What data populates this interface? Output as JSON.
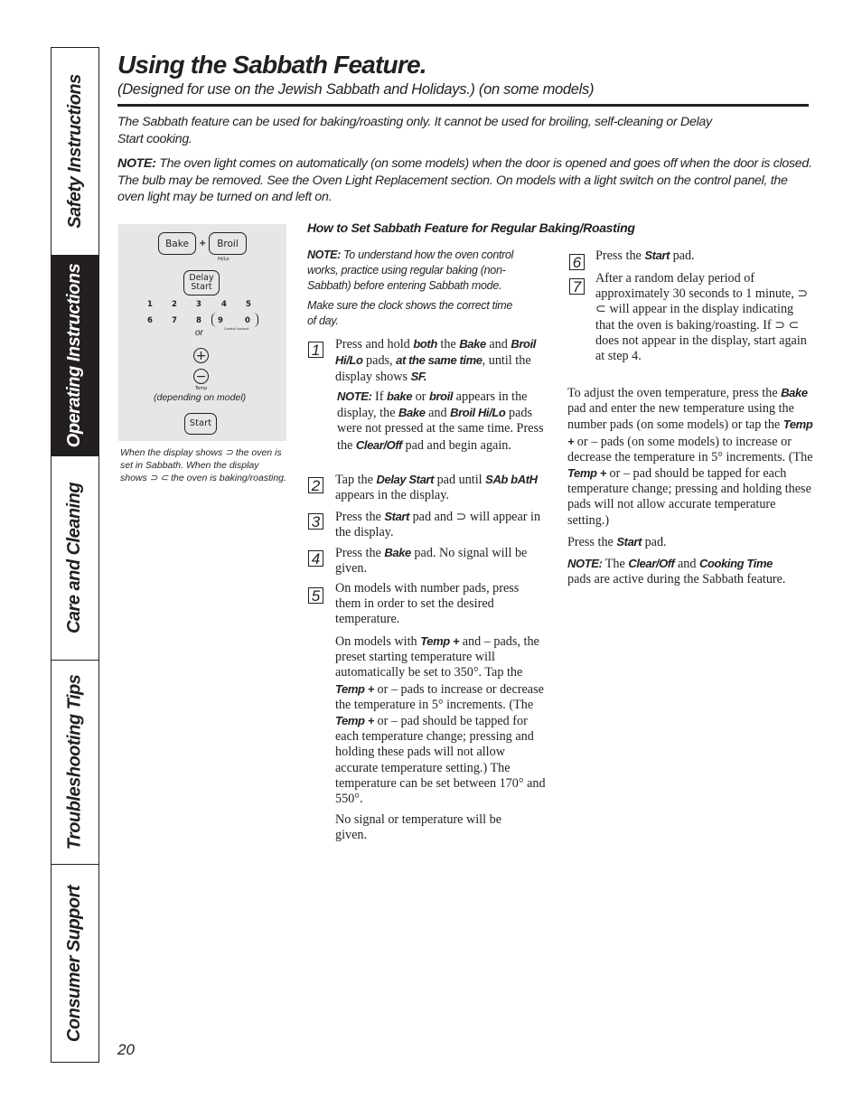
{
  "side_tabs": [
    {
      "label": "Safety Instructions",
      "active": false
    },
    {
      "label": "Operating Instructions",
      "active": true
    },
    {
      "label": "Care and Cleaning",
      "active": false
    },
    {
      "label": "Troubleshooting Tips",
      "active": false
    },
    {
      "label": "Consumer Support",
      "active": false
    }
  ],
  "header": {
    "title": "Using the Sabbath Feature.",
    "subtitle": "(Designed for use on the Jewish Sabbath and Holidays.) (on some models)"
  },
  "intro": {
    "line1": "The Sabbath feature can be used for baking/roasting only. It cannot be used for broiling, self-cleaning or Delay Start cooking.",
    "note_label": "NOTE:",
    "note_text": " The oven light comes on automatically (on some models) when the door is opened and goes off when the door is closed. The bulb may be removed. See the Oven Light Replacement section. On models with a light switch on the control panel, the oven light may be turned on and left on."
  },
  "panel": {
    "bake": "Bake",
    "plus": "+",
    "broil": "Broil",
    "hilo": "Hi/Lo",
    "delay_start": "Delay Start",
    "numbers": [
      "1",
      "2",
      "3",
      "4",
      "5",
      "6",
      "7",
      "8",
      "9",
      "0"
    ],
    "control_lockout": "Control Lockout",
    "or": "or",
    "temp_plus": "+",
    "temp_minus": "−",
    "temp": "Temp",
    "depending": "(depending on model)",
    "start": "Start"
  },
  "caption": "When the display shows ⊃ the oven is set in Sabbath. When the display shows ⊃ ⊂  the oven is baking/roasting.",
  "section": {
    "heading": "How to Set Sabbath Feature for Regular Baking/Roasting",
    "note1_label": "NOTE:",
    "note1_text": " To understand how the oven control works, practice using regular baking (non-Sabbath) before entering Sabbath mode.",
    "note2": "Make sure the clock shows the correct time of day.",
    "steps": [
      {
        "n": "1"
      },
      {
        "n": "2"
      },
      {
        "n": "3"
      },
      {
        "n": "4"
      },
      {
        "n": "5"
      },
      {
        "n": "6"
      },
      {
        "n": "7"
      }
    ],
    "s1": {
      "a": "Press and hold ",
      "b": "both",
      "c": " the ",
      "d": "Bake",
      "e": " and ",
      "f": "Broil Hi/Lo",
      "g": " pads, ",
      "h": "at the same time",
      "i": ", until the display shows ",
      "j": "SF."
    },
    "s1note": {
      "a": "NOTE:",
      "b": " If ",
      "c": "bake",
      "d": " or ",
      "e": "broil",
      "f": " appears in the display, the ",
      "g": "Bake",
      "h": " and ",
      "i": "Broil Hi/Lo",
      "j": " pads were not pressed at the same time. Press the ",
      "k": "Clear/Off",
      "l": " pad and begin again."
    },
    "s2": {
      "a": "Tap the ",
      "b": "Delay Start",
      "c": " pad until ",
      "d": "SAb bAtH",
      "e": " appears in the display."
    },
    "s3": {
      "a": "Press the ",
      "b": "Start",
      "c": " pad and ⊃ will appear in the display."
    },
    "s4": {
      "a": "Press the ",
      "b": "Bake",
      "c": " pad. No signal will be given."
    },
    "s5": {
      "a": "On models with number pads, press them in order to set the desired temperature."
    },
    "s5b": {
      "a": "On models with ",
      "b": "Temp +",
      "c": "  and – pads, the preset starting temperature will automatically be set to 350°. Tap the ",
      "d": "Temp +",
      "e": " or – pads to increase or decrease the temperature in 5° increments. (The ",
      "f": "Temp +",
      "g": " or – pad should be tapped for each temperature change; pressing and holding these pads will not allow accurate temperature setting.) The temperature can be set between 170° and 550°."
    },
    "s5c": "No signal or temperature will be given.",
    "s6": {
      "a": "Press the ",
      "b": "Start",
      "c": " pad."
    },
    "s7": "After a random delay period of approximately 30 seconds to 1 minute, ⊃ ⊂ will appear in the display indicating that the oven is baking/roasting. If ⊃ ⊂ does not appear in the display, start again at step 4.",
    "adjust": {
      "a": "To adjust the oven temperature, press the ",
      "b": "Bake",
      "c": " pad and enter the new temperature using the number pads (on some models) or tap the ",
      "d": "Temp +",
      "e": " or – pads (on some models) to increase or decrease the temperature in 5° increments. (The ",
      "f": "Temp +",
      "g": " or – pad should be tapped for each temperature change; pressing and holding these pads will not allow accurate temperature setting.)"
    },
    "press_start": {
      "a": "Press the ",
      "b": "Start",
      "c": " pad."
    },
    "final_note": {
      "a": "NOTE:",
      "b": " The ",
      "c": "Clear/Off",
      "d": " and ",
      "e": "Cooking Time",
      "f": " pads are active during the Sabbath feature."
    }
  },
  "page_number": "20"
}
